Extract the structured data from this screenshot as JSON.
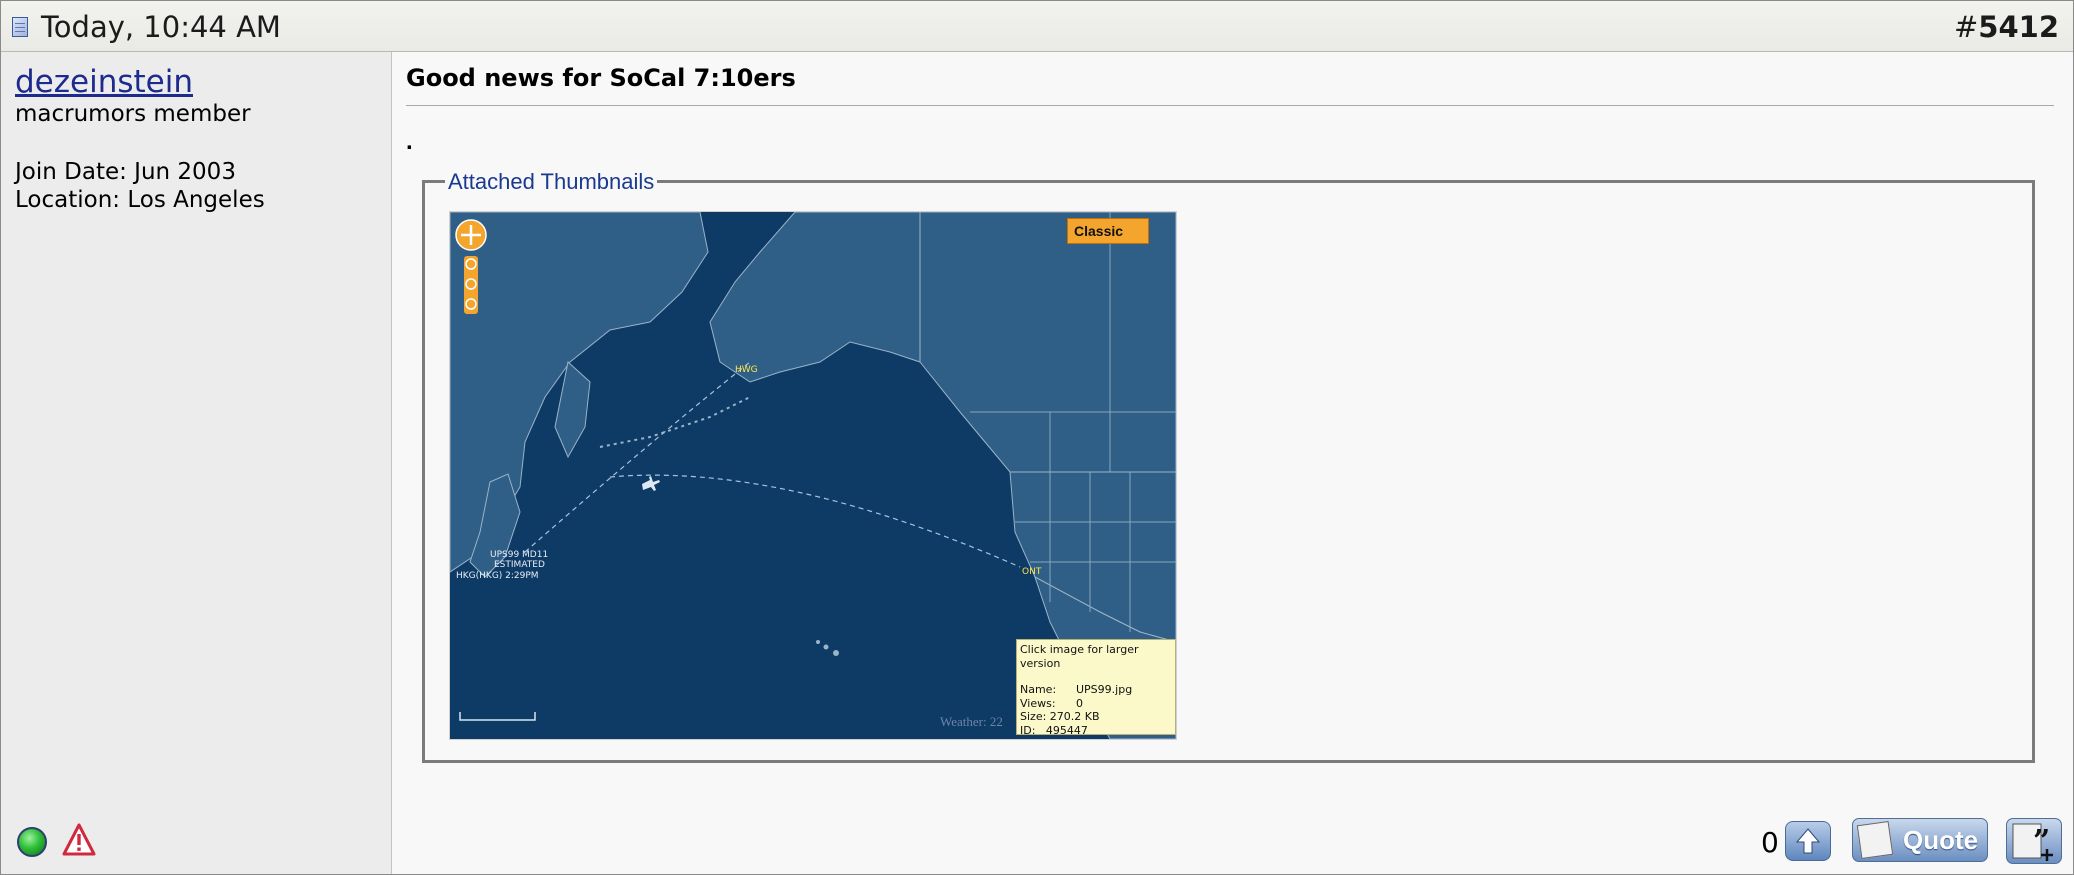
{
  "header": {
    "date": "Today, 10:44 AM",
    "post_number_prefix": "#",
    "post_number": "5412"
  },
  "user": {
    "username": "dezeinstein",
    "title": "macrumors member",
    "join_date": "Join Date: Jun 2003",
    "location": "Location: Los Angeles",
    "status_icon": "online-status-icon",
    "report_icon": "report-post-icon"
  },
  "post": {
    "title": "Good news for SoCal 7:10ers",
    "body": "."
  },
  "attachments": {
    "legend": "Attached Thumbnails",
    "map": {
      "mode_label": "Classic",
      "flight_label_top": "HWG",
      "callout_lines": [
        "UPS99 MD11",
        "ESTIMATED",
        "HKG(HKG) 2:29PM"
      ],
      "destination_label": "ONT",
      "weather_text": "Weather: 22"
    },
    "tooltip": {
      "hint": "Click image for larger version",
      "name_label": "Name:",
      "name_value": "UPS99.jpg",
      "views_label": "Views:",
      "views_value": "0",
      "size_label": "Size:",
      "size_value": "270.2 KB",
      "id_label": "ID:",
      "id_value": "495447"
    }
  },
  "footer": {
    "reputation_count": "0",
    "quote_label": "Quote",
    "icons": [
      "thumbs-up-arrow-icon",
      "quote-icon",
      "multi-quote-icon"
    ]
  },
  "colors": {
    "username_link": "#1d2b8f",
    "legend": "#1a3a8f",
    "map_ocean": "#0e3a66",
    "map_land": "#2f5f86",
    "map_accent": "#f3a52d"
  }
}
